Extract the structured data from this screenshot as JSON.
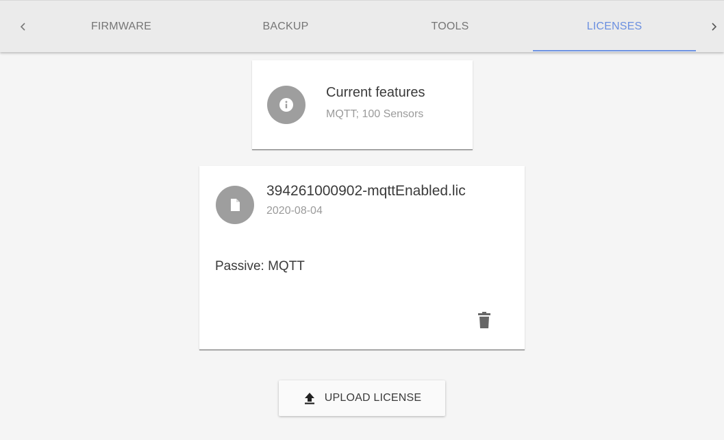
{
  "tabs": {
    "items": [
      {
        "label": "FIRMWARE"
      },
      {
        "label": "BACKUP"
      },
      {
        "label": "TOOLS"
      },
      {
        "label": "LICENSES"
      }
    ],
    "active": "LICENSES",
    "accent_color": "#6a8fe0"
  },
  "features": {
    "icon": "info-icon",
    "title": "Current features",
    "subtitle": "MQTT; 100 Sensors"
  },
  "license": {
    "icon": "file-icon",
    "filename": "394261000902-mqttEnabled.lic",
    "date": "2020-08-04",
    "description": "Passive: MQTT",
    "delete_icon": "trash-icon"
  },
  "upload": {
    "icon": "upload-icon",
    "label": "UPLOAD LICENSE"
  }
}
